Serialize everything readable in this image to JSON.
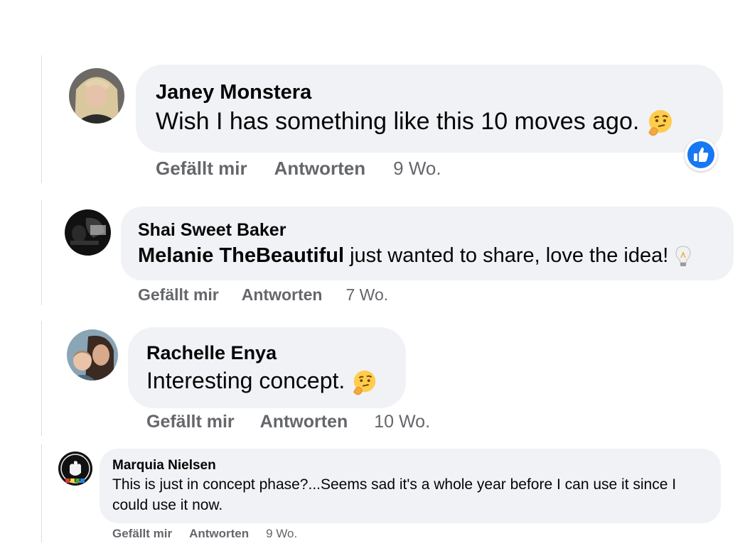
{
  "comments": [
    {
      "author": "Janey Monstera",
      "text": "Wish I has something like this 10 moves ago.",
      "emoji": "thinking-face-icon",
      "has_like_reaction": true,
      "like_label": "Gefällt mir",
      "reply_label": "Antworten",
      "time": "9 Wo."
    },
    {
      "author": "Shai Sweet Baker",
      "mention": "Melanie TheBeautiful",
      "text": " just wanted to share, love the idea!",
      "emoji": "light-bulb-icon",
      "like_label": "Gefällt mir",
      "reply_label": "Antworten",
      "time": "7 Wo."
    },
    {
      "author": "Rachelle Enya",
      "text": "Interesting concept.",
      "emoji": "thinking-face-icon",
      "like_label": "Gefällt mir",
      "reply_label": "Antworten",
      "time": "10 Wo."
    },
    {
      "author": "Marquia Nielsen",
      "text_line1": "This is just in concept phase?...Seems sad it's a whole year before I can use it since I",
      "text_line2": "could use it now.",
      "like_label": "Gefällt mir",
      "reply_label": "Antworten",
      "time": "9 Wo."
    }
  ],
  "colors": {
    "bubble": "#f0f2f5",
    "secondary_text": "#65676b",
    "like_blue": "#1877f2"
  }
}
